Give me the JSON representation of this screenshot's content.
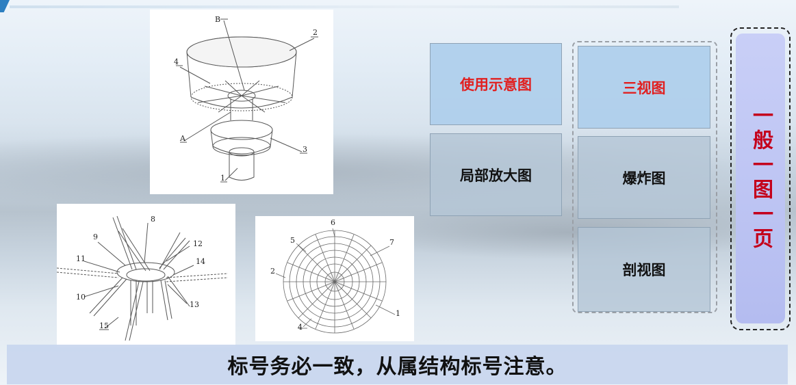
{
  "figures": {
    "iso": {
      "labels": [
        "B",
        "2",
        "4",
        "A",
        "3",
        "1"
      ]
    },
    "hub": {
      "labels": [
        "8",
        "9",
        "12",
        "11",
        "14",
        "10",
        "13",
        "15"
      ]
    },
    "plan": {
      "labels": [
        "6",
        "5",
        "7",
        "2",
        "1",
        "4"
      ]
    }
  },
  "boxes": {
    "usage": "使用示意图",
    "detail": "局部放大图",
    "three_view": "三视图",
    "exploded": "爆炸图",
    "section": "剖视图"
  },
  "side_label": "一般一图一页",
  "banner": "标号务必一致，从属结构标号注意。",
  "colors": {
    "accent_red": "#e11f1f",
    "side_red": "#c4001c",
    "box_blue": "#aecdec",
    "corner_blue": "#2e7fc1"
  }
}
